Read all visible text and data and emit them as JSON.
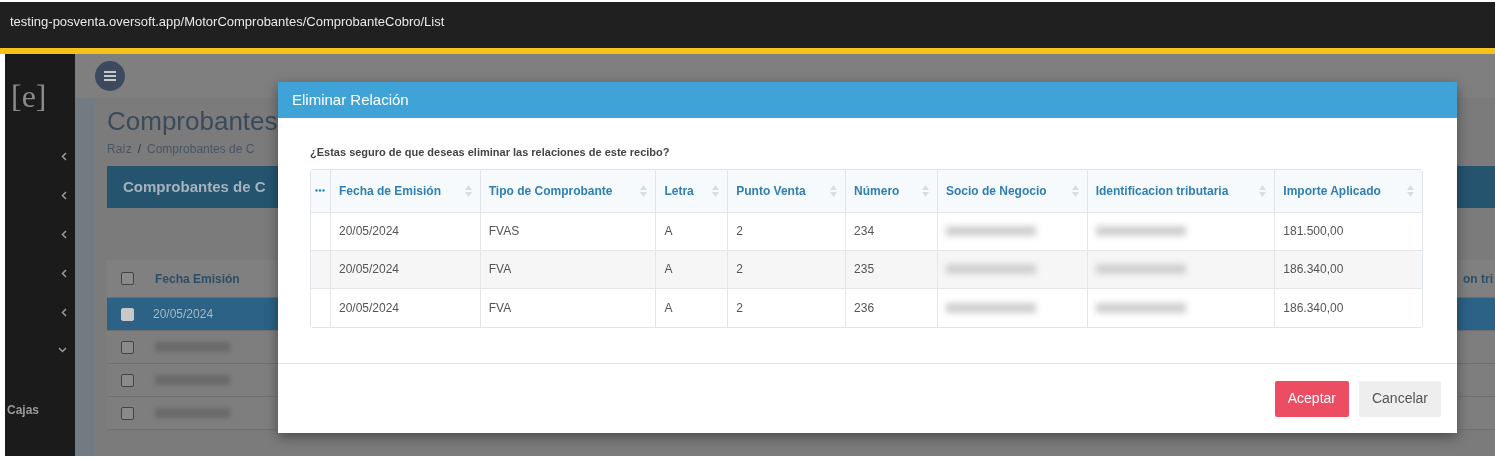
{
  "browser": {
    "url": "testing-posventa.oversoft.app/MotorComprobantes/ComprobanteCobro/List"
  },
  "sidebar": {
    "logo": "[e]",
    "items": [
      {
        "kind": "collapsed"
      },
      {
        "kind": "collapsed"
      },
      {
        "kind": "collapsed"
      },
      {
        "kind": "collapsed"
      },
      {
        "kind": "collapsed"
      },
      {
        "kind": "expanded"
      }
    ],
    "footer_label": "Cajas"
  },
  "page": {
    "title": "Comprobantes",
    "breadcrumb": [
      "Raíz",
      "Comprobantes de C"
    ],
    "breadcrumb_separator": "/",
    "panel_title": "Comprobantes de C",
    "table": {
      "select_all_checked": false,
      "columns": [
        "Fecha Emisión"
      ],
      "right_column": "on tri",
      "rows": [
        {
          "selected": true,
          "date": "20/05/2024"
        },
        {
          "selected": false,
          "date": null
        },
        {
          "selected": false,
          "date": null
        },
        {
          "selected": false,
          "date": null
        }
      ]
    }
  },
  "dialog": {
    "title": "Eliminar Relación",
    "message": "¿Estas seguro de que deseas eliminar las relaciones de este recibo?",
    "columns": [
      "Fecha de Emisión",
      "Tipo de Comprobante",
      "Letra",
      "Punto Venta",
      "Número",
      "Socio de Negocio",
      "Identificacion tributaria",
      "Importe Aplicado"
    ],
    "rows": [
      {
        "cells": [
          {
            "text": "20/05/2024"
          },
          {
            "text": "FVAS"
          },
          {
            "text": "A"
          },
          {
            "text": "2"
          },
          {
            "text": "234"
          },
          {
            "redacted": true
          },
          {
            "redacted": true
          },
          {
            "text": "181.500,00"
          }
        ]
      },
      {
        "cells": [
          {
            "text": "20/05/2024"
          },
          {
            "text": "FVA"
          },
          {
            "text": "A"
          },
          {
            "text": "2"
          },
          {
            "text": "235"
          },
          {
            "redacted": true
          },
          {
            "redacted": true
          },
          {
            "text": "186.340,00"
          }
        ]
      },
      {
        "cells": [
          {
            "text": "20/05/2024"
          },
          {
            "text": "FVA"
          },
          {
            "text": "A"
          },
          {
            "text": "2"
          },
          {
            "text": "236"
          },
          {
            "redacted": true
          },
          {
            "redacted": true
          },
          {
            "text": "186.340,00"
          }
        ]
      }
    ],
    "buttons": [
      {
        "label": "Aceptar",
        "kind": "primary"
      },
      {
        "label": "Cancelar",
        "kind": "secondary"
      }
    ]
  }
}
